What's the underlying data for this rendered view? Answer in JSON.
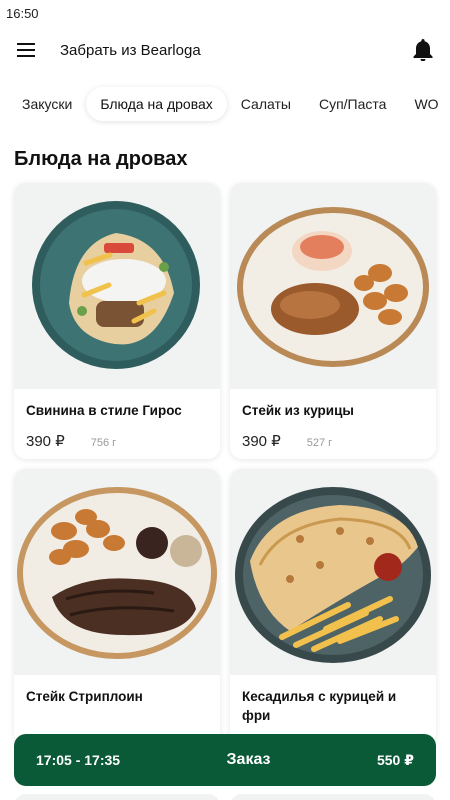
{
  "status_bar": {
    "time": "16:50"
  },
  "header": {
    "title": "Забрать из Bearloga"
  },
  "tabs": [
    {
      "label": "Закуски",
      "active": false
    },
    {
      "label": "Блюда на дровах",
      "active": true
    },
    {
      "label": "Салаты",
      "active": false
    },
    {
      "label": "Суп/Паста",
      "active": false
    },
    {
      "label": "WO",
      "active": false
    }
  ],
  "section": {
    "title": "Блюда на дровах"
  },
  "products": [
    {
      "name": "Свинина в стиле Гирос",
      "price": "390 ₽",
      "weight": "756 г"
    },
    {
      "name": "Стейк из курицы",
      "price": "390 ₽",
      "weight": "527 г"
    },
    {
      "name": "Стейк Стриплоин",
      "price": "",
      "weight": ""
    },
    {
      "name": "Кесадилья с курицей и фри",
      "price": "",
      "weight": ""
    }
  ],
  "order_bar": {
    "time": "17:05 - 17:35",
    "label": "Заказ",
    "total": "550 ₽"
  },
  "colors": {
    "accent": "#0b5a37"
  }
}
